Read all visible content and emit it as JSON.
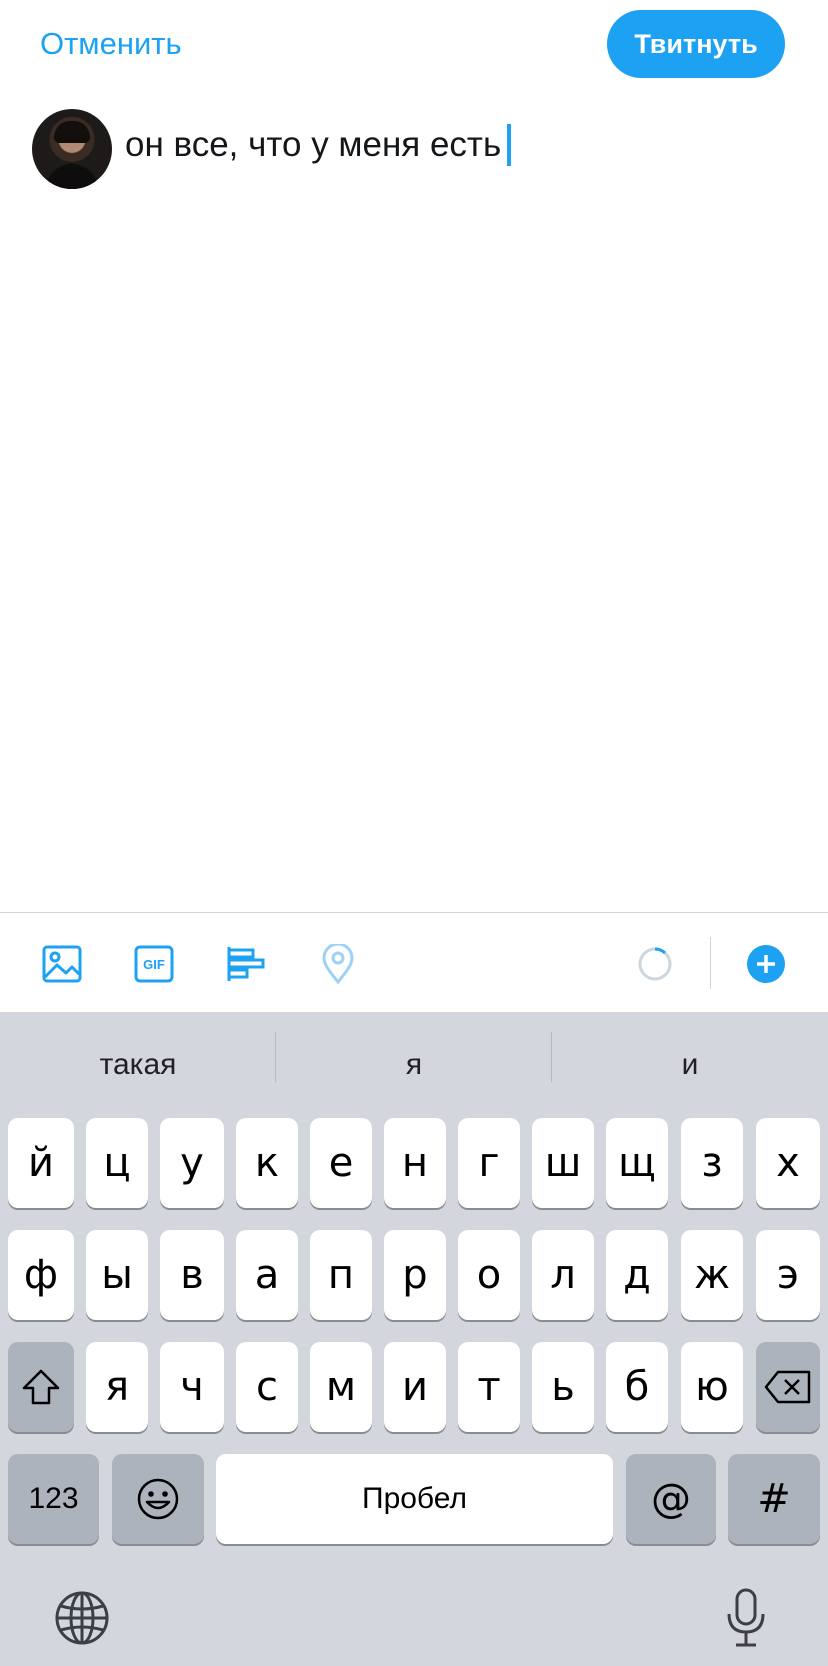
{
  "header": {
    "cancel_label": "Отменить",
    "tweet_label": "Твитнуть"
  },
  "compose": {
    "text": "он все, что у меня есть",
    "avatar_icon": "user-avatar"
  },
  "toolbar": {
    "icons": [
      "image-icon",
      "gif-icon",
      "poll-icon",
      "location-icon",
      "character-counter-icon",
      "add-thread-icon"
    ],
    "gif_label": "GIF",
    "accent_color": "#1da1f2"
  },
  "keyboard": {
    "suggestions": [
      "такая",
      "я",
      "и"
    ],
    "row1": [
      "й",
      "ц",
      "у",
      "к",
      "е",
      "н",
      "г",
      "ш",
      "щ",
      "з",
      "х"
    ],
    "row2": [
      "ф",
      "ы",
      "в",
      "а",
      "п",
      "р",
      "о",
      "л",
      "д",
      "ж",
      "э"
    ],
    "row3": [
      "я",
      "ч",
      "с",
      "м",
      "и",
      "т",
      "ь",
      "б",
      "ю"
    ],
    "numbers_label": "123",
    "space_label": "Пробел",
    "at_label": "@",
    "hash_label": "#",
    "icons": [
      "shift-icon",
      "backspace-icon",
      "emoji-icon",
      "globe-icon",
      "microphone-icon"
    ]
  }
}
